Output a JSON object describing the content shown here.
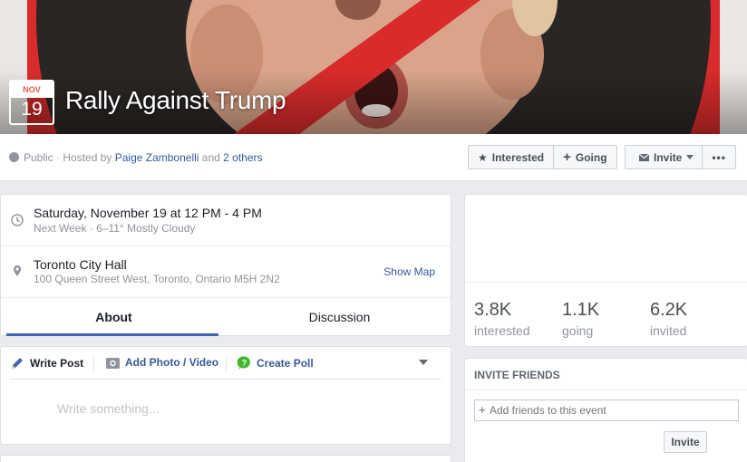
{
  "cover": {
    "month": "NOV",
    "day": "19",
    "title": "Rally Against Trump"
  },
  "host": {
    "privacy": "Public",
    "hosted_by_prefix": "· Hosted by",
    "host_name": "Paige Zambonelli",
    "and": "and",
    "others": "2 others"
  },
  "actions": {
    "interested": "Interested",
    "going": "Going",
    "invite": "Invite",
    "more": "•••"
  },
  "details": {
    "datetime": "Saturday, November 19 at 12 PM - 4 PM",
    "weather": "Next Week · 6–11° Mostly Cloudy",
    "location_name": "Toronto City Hall",
    "location_address": "100 Queen Street West, Toronto, Ontario M5H 2N2",
    "show_map": "Show Map"
  },
  "tabs": {
    "about": "About",
    "discussion": "Discussion"
  },
  "composer": {
    "write_post": "Write Post",
    "add_photo": "Add Photo / Video",
    "create_poll": "Create Poll",
    "placeholder": "Write something..."
  },
  "stats": {
    "interested_count": "3.8K",
    "interested_label": "interested",
    "going_count": "1.1K",
    "going_label": "going",
    "invited_count": "6.2K",
    "invited_label": "invited"
  },
  "invite_friends": {
    "heading": "INVITE FRIENDS",
    "placeholder": "Add friends to this event",
    "button": "Invite"
  },
  "colors": {
    "link": "#365899",
    "accent": "#4267b2",
    "prohibition_red": "#d92b2b"
  }
}
